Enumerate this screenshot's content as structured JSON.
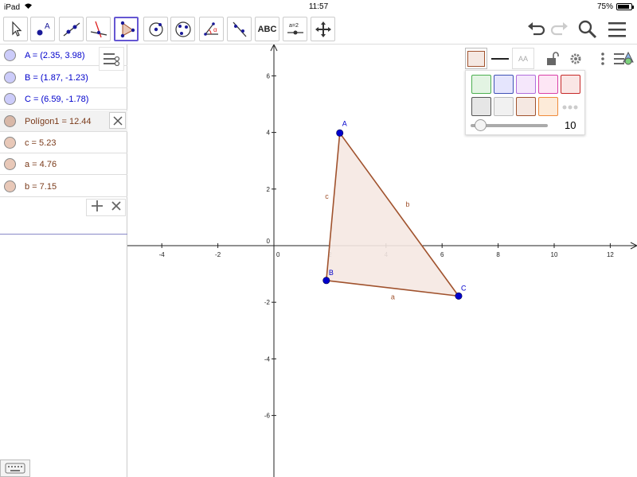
{
  "status": {
    "device": "iPad",
    "time": "11:57",
    "battery": "75%",
    "battery_level": 0.75
  },
  "toolbar": {
    "tools": [
      {
        "icon": "move-arrow-icon"
      },
      {
        "icon": "point-icon",
        "label": "A"
      },
      {
        "icon": "line-icon"
      },
      {
        "icon": "perpendicular-line-icon"
      },
      {
        "icon": "polygon-icon",
        "active": true
      },
      {
        "icon": "circle-center-icon"
      },
      {
        "icon": "circle-three-points-icon"
      },
      {
        "icon": "angle-icon",
        "label": "α"
      },
      {
        "icon": "reflect-line-icon"
      },
      {
        "icon": "text-tool-icon",
        "label": "ABC"
      },
      {
        "icon": "slider-tool-icon",
        "label": "a=2"
      },
      {
        "icon": "move-graphics-icon"
      }
    ],
    "right": [
      "undo-icon",
      "redo-icon",
      "search-icon",
      "menu-icon"
    ]
  },
  "algebra": {
    "items": [
      {
        "text": "A = (2.35, 3.98)",
        "kind": "point"
      },
      {
        "text": "B = (1.87, -1.23)",
        "kind": "point"
      },
      {
        "text": "C = (6.59, -1.78)",
        "kind": "point"
      },
      {
        "text": "Polígon1 = 12.44",
        "kind": "polygon",
        "selected": true
      },
      {
        "text": "c = 5.23",
        "kind": "segment"
      },
      {
        "text": "a = 4.76",
        "kind": "segment"
      },
      {
        "text": "b = 7.15",
        "kind": "segment"
      }
    ]
  },
  "graphics": {
    "x_ticks": [
      "-4",
      "-2",
      "0",
      "2",
      "4",
      "6",
      "8",
      "10",
      "12"
    ],
    "y_ticks": [
      "6",
      "4",
      "2",
      "0",
      "-2",
      "-4",
      "-6"
    ],
    "points": [
      {
        "name": "A",
        "x": 2.35,
        "y": 3.98
      },
      {
        "name": "B",
        "x": 1.87,
        "y": -1.23
      },
      {
        "name": "C",
        "x": 6.59,
        "y": -1.78
      }
    ],
    "segments": [
      {
        "name": "c",
        "from": "A",
        "to": "B"
      },
      {
        "name": "a",
        "from": "B",
        "to": "C"
      },
      {
        "name": "b",
        "from": "A",
        "to": "C"
      }
    ]
  },
  "stylebar": {
    "font_label": "AA",
    "palette_colors": [
      "#e3f4e3",
      "#e5e5fd",
      "#f5e7fb",
      "#fde6f5",
      "#fae6e5",
      "#e6e6e6",
      "#f1f1f1",
      "#f5e8e2",
      "#fdebd9"
    ],
    "palette_borders": [
      "#4caf50",
      "#3f51b5",
      "#b06ddc",
      "#d940a8",
      "#c62828",
      "#555555",
      "#bbbbbb",
      "#a0522d",
      "#ef8a3a"
    ],
    "opacity_value": "10"
  },
  "colors": {
    "point": "#0000cc",
    "polygon_line": "#a0522d",
    "polygon_fill": "#f5e8e2",
    "point_icon_fill": "#ccccfa",
    "seg_icon_fill": "#e8c8b8"
  }
}
